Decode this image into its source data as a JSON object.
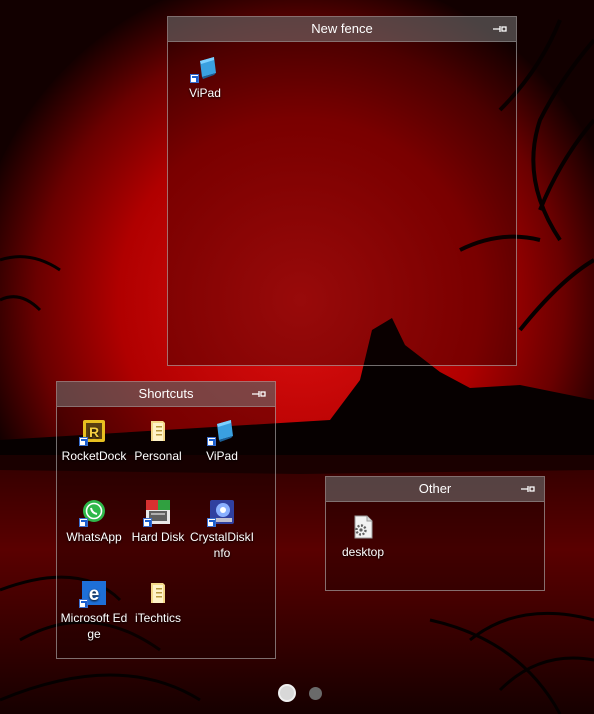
{
  "fences": {
    "new_fence": {
      "title": "New fence",
      "items": [
        {
          "label": "ViPad",
          "icon": "vipad-icon"
        }
      ]
    },
    "shortcuts": {
      "title": "Shortcuts",
      "items": [
        {
          "label": "RocketDock",
          "icon": "rocketdock-icon"
        },
        {
          "label": "Personal",
          "icon": "folder-icon"
        },
        {
          "label": "ViPad",
          "icon": "vipad-icon"
        },
        {
          "label": "WhatsApp",
          "icon": "whatsapp-icon"
        },
        {
          "label": "Hard Disk",
          "icon": "hard-disk-icon"
        },
        {
          "label": "CrystalDiskInfo",
          "icon": "crystaldiskinfo-icon"
        },
        {
          "label": "Microsoft Edge",
          "icon": "edge-icon"
        },
        {
          "label": "iTechtics",
          "icon": "folder-icon"
        }
      ]
    },
    "other": {
      "title": "Other",
      "items": [
        {
          "label": "desktop",
          "icon": "settings-file-icon"
        }
      ]
    }
  },
  "pager": {
    "pages": 2,
    "current": 1
  },
  "colors": {
    "accent": "#d00000",
    "fence_title_bg": "#7a7a7a"
  }
}
